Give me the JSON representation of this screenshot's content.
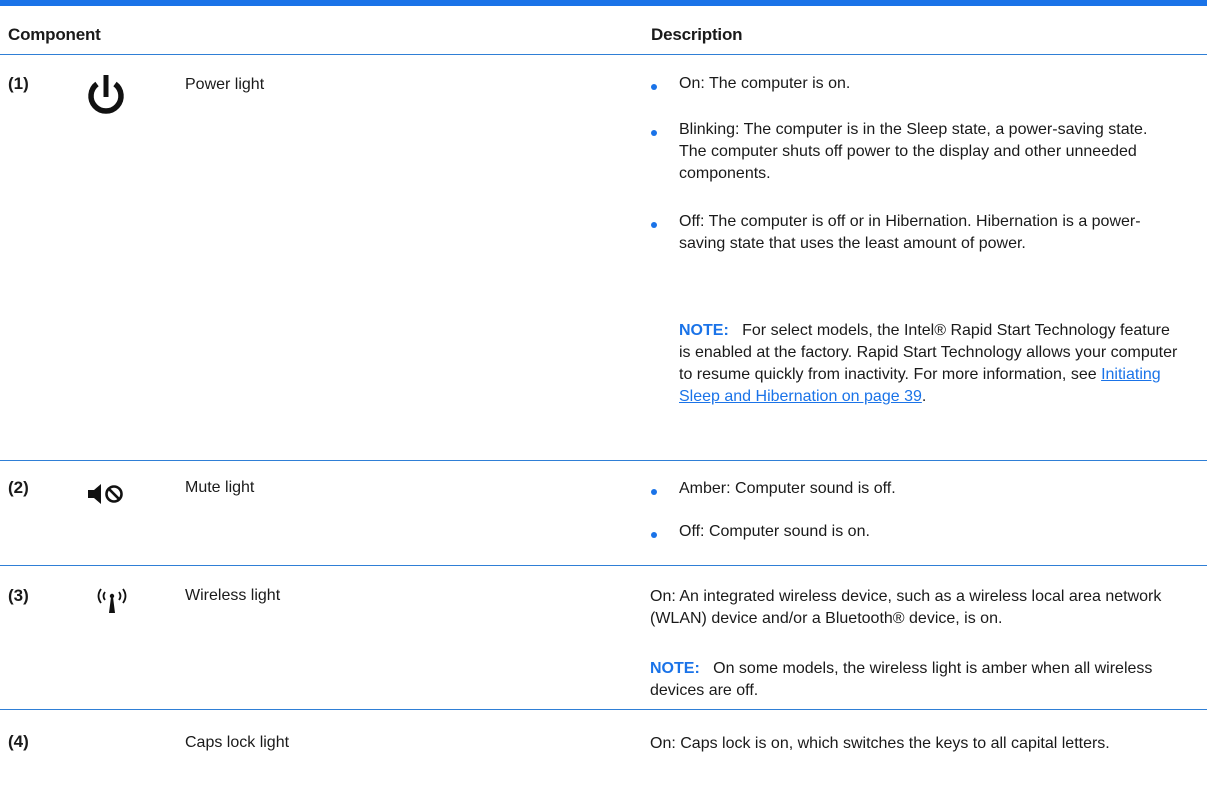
{
  "header": {
    "component": "Component",
    "description": "Description"
  },
  "colors": {
    "accent": "#1a73e8",
    "rule": "#2f7fd6",
    "text": "#1a1a1a"
  },
  "rows": [
    {
      "number": "(1)",
      "icon": "power-icon",
      "name": "Power light",
      "bullets": [
        "On: The computer is on.",
        "Blinking: The computer is in the Sleep state, a power-saving state. The computer shuts off power to the display and other unneeded components.",
        "Off: The computer is off or in Hibernation. Hibernation is a power-saving state that uses the least amount of power."
      ],
      "note": {
        "label": "NOTE:",
        "text": "For select models, the Intel® Rapid Start Technology feature is enabled at the factory. Rapid Start Technology allows your computer to resume quickly from inactivity. For more information, see",
        "link": "Initiating Sleep and Hibernation on page 39",
        "end": "."
      }
    },
    {
      "number": "(2)",
      "icon": "mute-icon",
      "name": "Mute light",
      "bullets": [
        "Amber: Computer sound is off.",
        "Off: Computer sound is on."
      ]
    },
    {
      "number": "(3)",
      "icon": "wireless-icon",
      "name": "Wireless light",
      "text": "On: An integrated wireless device, such as a wireless local area network (WLAN) device and/or a Bluetooth® device, is on.",
      "note": {
        "label": "NOTE:",
        "text": "On some models, the wireless light is amber when all wireless devices are off."
      }
    },
    {
      "number": "(4)",
      "icon": "",
      "name": "Caps lock light",
      "text": "On: Caps lock is on, which switches the keys to all capital letters."
    }
  ]
}
